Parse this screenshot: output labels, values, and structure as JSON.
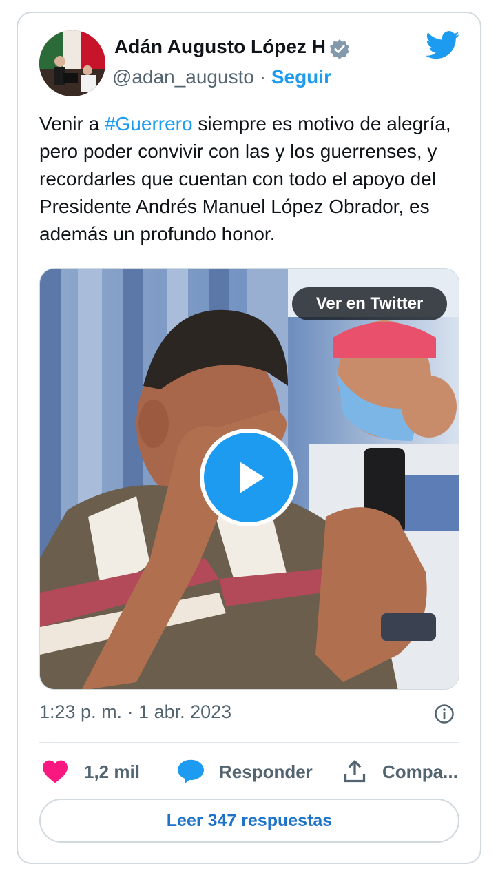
{
  "author": {
    "name": "Adán Augusto López H",
    "handle": "@adan_augusto",
    "separator": "·",
    "follow_label": "Seguir",
    "verified_icon": "verified-badge-icon"
  },
  "tweet": {
    "text_prefix": "Venir a ",
    "hashtag": "#Guerrero",
    "text_suffix": " siempre es motivo de alegría, pero poder convivir con las y los guerrenses, y recordarles que cuentan con todo el apoyo del Presidente Andrés Manuel López Obrador, es además un profundo honor."
  },
  "media": {
    "view_on_twitter_label": "Ver en Twitter",
    "play_icon": "play-icon"
  },
  "meta": {
    "timestamp": "1:23 p. m. · 1 abr. 2023"
  },
  "actions": {
    "like_count": "1,2 mil",
    "reply_label": "Responder",
    "share_label": "Compa..."
  },
  "read_replies_label": "Leer 347 respuestas",
  "colors": {
    "accent": "#1d9bf0",
    "like": "#f91880",
    "text": "#0f1419",
    "secondary": "#536471"
  }
}
